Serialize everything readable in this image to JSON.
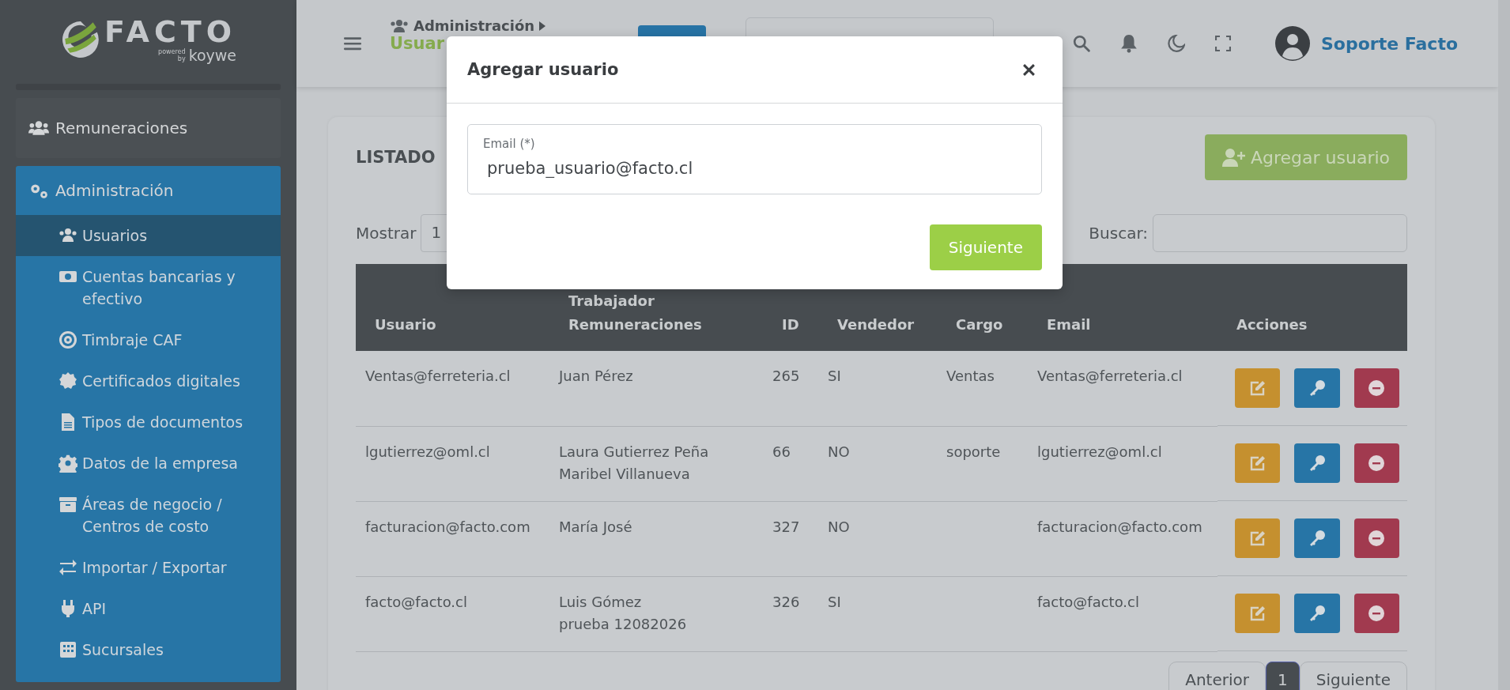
{
  "brand": {
    "name": "FACTO",
    "powered": "powered",
    "by": "by",
    "partner": "koywe"
  },
  "sidebar": {
    "sections": [
      {
        "label": "Remuneraciones",
        "expanded": false
      },
      {
        "label": "Administración",
        "expanded": true,
        "children": [
          {
            "label": "Usuarios",
            "selected": true
          },
          {
            "label": "Cuentas bancarias y efectivo",
            "selected": false
          },
          {
            "label": "Timbraje CAF",
            "selected": false
          },
          {
            "label": "Certificados digitales",
            "selected": false
          },
          {
            "label": "Tipos de documentos",
            "selected": false
          },
          {
            "label": "Datos de la empresa",
            "selected": false
          },
          {
            "label": "Áreas de negocio / Centros de costo",
            "selected": false
          },
          {
            "label": "Importar / Exportar",
            "selected": false
          },
          {
            "label": "API",
            "selected": false
          },
          {
            "label": "Sucursales",
            "selected": false
          }
        ]
      }
    ]
  },
  "header": {
    "breadcrumb_parent": "Administración",
    "breadcrumb_current": "Usuar",
    "user_name": "Soporte Facto"
  },
  "page": {
    "title": "LISTADO",
    "add_button": "Agregar usuario",
    "show_label": "Mostrar",
    "page_size": "1",
    "search_label": "Buscar:"
  },
  "table": {
    "columns": [
      "Usuario",
      "Trabajador Remuneraciones",
      "ID",
      "Vendedor",
      "Cargo",
      "Email",
      "Acciones"
    ],
    "rows": [
      {
        "usuario": "Ventas@ferreteria.cl",
        "workers": [
          "Juan Pérez"
        ],
        "id": "265",
        "vendedor": "SI",
        "cargo": "Ventas",
        "email": "Ventas@ferreteria.cl"
      },
      {
        "usuario": "lgutierrez@oml.cl",
        "workers": [
          "Laura Gutierrez Peña",
          "Maribel Villanueva"
        ],
        "id": "66",
        "vendedor": "NO",
        "cargo": "soporte",
        "email": "lgutierrez@oml.cl"
      },
      {
        "usuario": "facturacion@facto.com",
        "workers": [
          "María José"
        ],
        "id": "327",
        "vendedor": "NO",
        "email": "facturacion@facto.com"
      },
      {
        "usuario": "facto@facto.cl",
        "workers": [
          "Luis Gómez",
          "prueba 12082026"
        ],
        "id": "326",
        "vendedor": "SI",
        "email": "facto@facto.cl"
      }
    ],
    "row_actions": [
      {
        "kind": "edit"
      },
      {
        "kind": "key"
      },
      {
        "kind": "remove"
      }
    ]
  },
  "pagination": {
    "previous": "Anterior",
    "pages": [
      {
        "label": "1",
        "selected": true
      }
    ],
    "next": "Siguiente"
  },
  "modal": {
    "title": "Agregar usuario",
    "field_label": "Email (*)",
    "field_value": "prueba_usuario@facto.cl",
    "submit": "Siguiente"
  }
}
